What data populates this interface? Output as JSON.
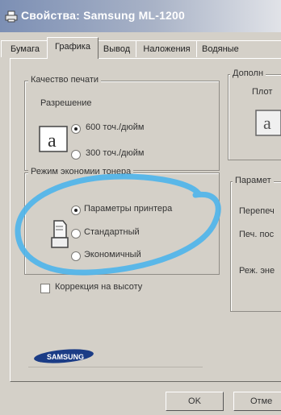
{
  "window": {
    "title": "Свойства: Samsung ML-1200",
    "title_icon": "printer-icon"
  },
  "tabs": [
    {
      "label": "Бумага",
      "active": false
    },
    {
      "label": "Графика",
      "active": true
    },
    {
      "label": "Вывод",
      "active": false
    },
    {
      "label": "Наложения",
      "active": false
    },
    {
      "label": "Водяные",
      "active": false
    }
  ],
  "quality_group": {
    "legend": "Качество печати",
    "resolution_label": "Разрешение",
    "options": [
      {
        "label": "600 точ./дюйм",
        "checked": true
      },
      {
        "label": "300 точ./дюйм",
        "checked": false
      }
    ]
  },
  "toner_group": {
    "legend": "Режим экономии тонера",
    "options": [
      {
        "label": "Параметры принтера",
        "checked": true
      },
      {
        "label": "Стандартный",
        "checked": false
      },
      {
        "label": "Экономичный",
        "checked": false
      }
    ]
  },
  "height_correction": {
    "label": "Коррекция на высоту",
    "checked": false
  },
  "right_groups": {
    "additional_legend": "Дополн",
    "density_label": "Плот",
    "params_legend": "Парамет",
    "row1": "Перепеч",
    "row2": "Печ. пос",
    "row3": "Реж. эне"
  },
  "brand": {
    "name": "SAMSUNG"
  },
  "buttons": {
    "ok": "OK",
    "cancel": "Отме"
  },
  "colors": {
    "accent_annotation": "#4fb4ea",
    "titlebar_start": "#7c8fb4",
    "titlebar_end": "#e1e3e8"
  }
}
